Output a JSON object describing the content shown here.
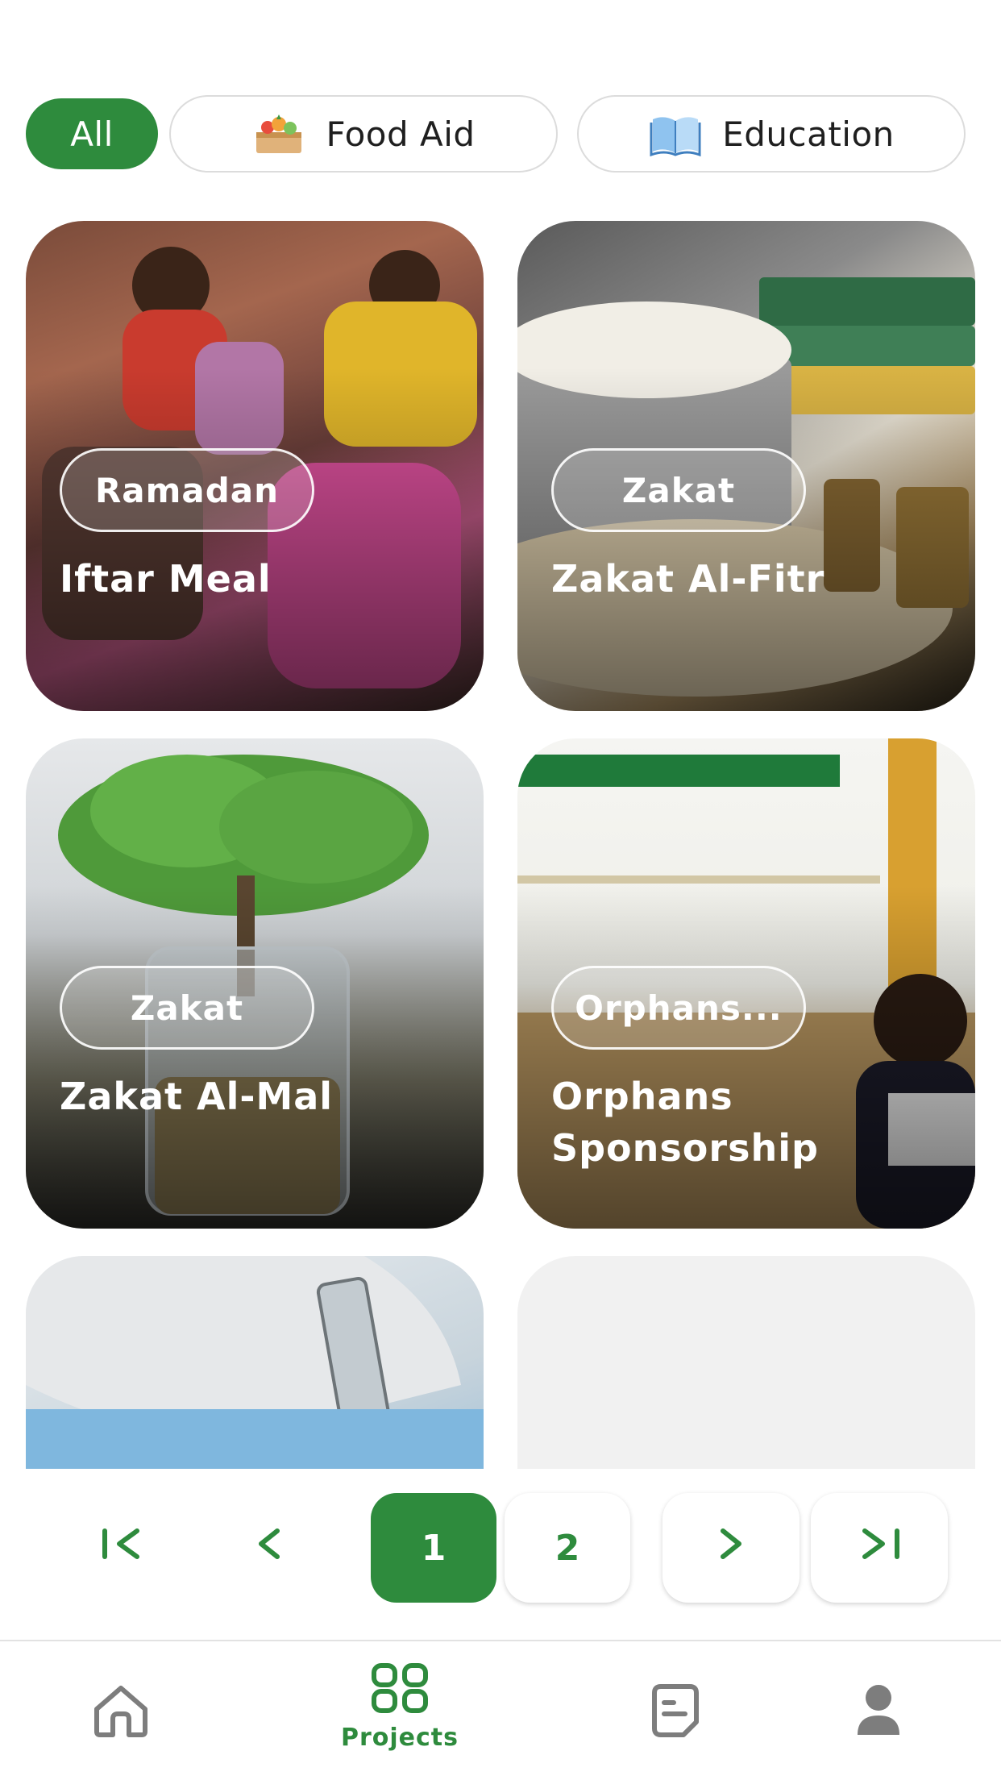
{
  "filters": {
    "all_label": "All",
    "food_label": "Food Aid",
    "education_label": "Education",
    "food_icon": "food-basket-icon",
    "education_icon": "open-book-icon"
  },
  "cards": [
    {
      "tag": "Ramadan",
      "title": "Iftar Meal"
    },
    {
      "tag": "Zakat",
      "title": "Zakat Al-Fitr"
    },
    {
      "tag": "Zakat",
      "title": "Zakat Al-Mal"
    },
    {
      "tag": "Orphans...",
      "title": "Orphans Sponsorship"
    }
  ],
  "pagination": {
    "first_icon": "first-page-icon",
    "prev_icon": "chevron-left-icon",
    "pages": [
      "1",
      "2"
    ],
    "current": "1",
    "next_icon": "chevron-right-icon",
    "last_icon": "last-page-icon"
  },
  "nav": {
    "home_icon": "home-icon",
    "projects_label": "Projects",
    "projects_icon": "grid-icon",
    "notes_icon": "document-icon",
    "profile_icon": "user-icon"
  },
  "colors": {
    "accent": "#2e8b3d"
  }
}
